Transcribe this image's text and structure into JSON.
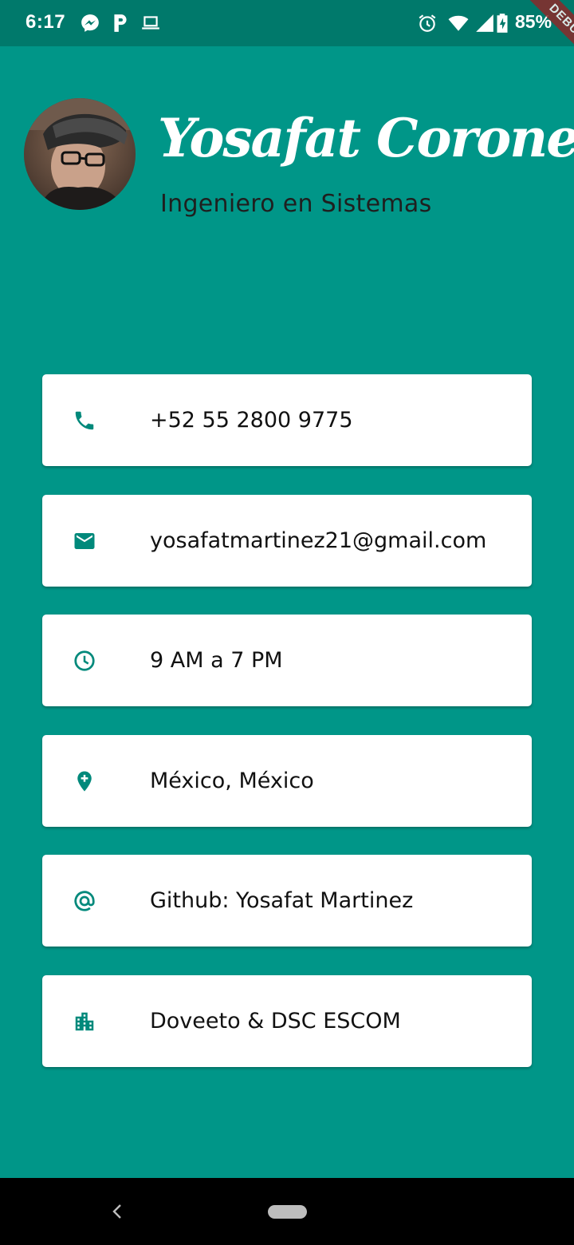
{
  "status_bar": {
    "time": "6:17",
    "battery": "85%",
    "debug_label": "DEBUG",
    "icons": [
      "messenger-icon",
      "p-icon",
      "laptop-icon",
      "alarm-icon",
      "wifi-icon",
      "signal-icon",
      "battery-charging-icon"
    ]
  },
  "profile": {
    "name": "Yosafat Coronel",
    "subtitle": "Ingeniero en Sistemas"
  },
  "contact": {
    "items": [
      {
        "icon": "phone-icon",
        "text": "+52 55 2800 9775"
      },
      {
        "icon": "mail-icon",
        "text": "yosafatmartinez21@gmail.com"
      },
      {
        "icon": "clock-icon",
        "text": "9 AM a 7 PM"
      },
      {
        "icon": "location-add-icon",
        "text": "México, México"
      },
      {
        "icon": "at-icon",
        "text": "Github: Yosafat Martinez"
      },
      {
        "icon": "building-icon",
        "text": "Doveeto & DSC ESCOM"
      }
    ]
  },
  "colors": {
    "background": "#009688",
    "status_bar": "#00796B",
    "icon": "#00897B",
    "card": "#ffffff"
  }
}
